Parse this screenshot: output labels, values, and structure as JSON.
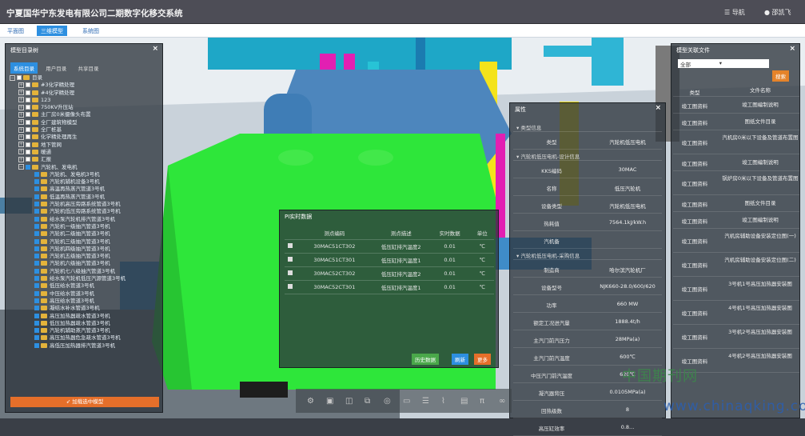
{
  "app": {
    "title": "宁夏国华宁东发电有限公司二期数字化移交系统",
    "nav_label": "导航",
    "user": "邵凯飞",
    "nav_icon": "menu-icon",
    "user_icon": "user-icon"
  },
  "view_tabs": [
    {
      "label": "平面图",
      "active": false
    },
    {
      "label": "三维模型",
      "active": true
    },
    {
      "label": "系统图",
      "active": false
    }
  ],
  "tree": {
    "title": "模型目录树",
    "tabs": [
      {
        "label": "系统目录",
        "active": true
      },
      {
        "label": "用户目录",
        "active": false
      },
      {
        "label": "共享目录",
        "active": false
      }
    ],
    "items": [
      {
        "label": "目录",
        "level": 0,
        "folder": true,
        "checked": false,
        "exp": "−"
      },
      {
        "label": "#3化学精处理",
        "level": 1,
        "folder": true,
        "checked": false,
        "exp": "+"
      },
      {
        "label": "#4化学精处理",
        "level": 1,
        "folder": true,
        "checked": false,
        "exp": "+"
      },
      {
        "label": "123",
        "level": 1,
        "folder": true,
        "checked": false,
        "exp": "+"
      },
      {
        "label": "750KV升压站",
        "level": 1,
        "folder": true,
        "checked": false,
        "exp": "+"
      },
      {
        "label": "主厂房0米摄像头布置",
        "level": 1,
        "folder": true,
        "checked": false,
        "exp": "+"
      },
      {
        "label": "全厂建筑物模型",
        "level": 1,
        "folder": true,
        "checked": false,
        "exp": "+"
      },
      {
        "label": "全厂桩基",
        "level": 1,
        "folder": true,
        "checked": false,
        "exp": "+"
      },
      {
        "label": "化学精处理再生",
        "level": 1,
        "folder": true,
        "checked": false,
        "exp": "+"
      },
      {
        "label": "地下管网",
        "level": 1,
        "folder": true,
        "checked": false,
        "exp": "+"
      },
      {
        "label": "暖通",
        "level": 1,
        "folder": true,
        "checked": false,
        "exp": "+"
      },
      {
        "label": "汇报",
        "level": 1,
        "folder": true,
        "checked": false,
        "exp": "+"
      },
      {
        "label": "汽轮机、发电机",
        "level": 1,
        "folder": true,
        "checked": true,
        "exp": "−"
      },
      {
        "label": "汽轮机、发电机3号机",
        "level": 2,
        "folder": true,
        "checked": true,
        "exp": ""
      },
      {
        "label": "汽轮机辅机设备3号机",
        "level": 2,
        "folder": true,
        "checked": true,
        "exp": ""
      },
      {
        "label": "高温再热蒸汽管道3号机",
        "level": 2,
        "folder": true,
        "checked": true,
        "exp": ""
      },
      {
        "label": "低温再热蒸汽管道3号机",
        "level": 2,
        "folder": true,
        "checked": true,
        "exp": ""
      },
      {
        "label": "汽轮机高压旁路系统管道3号机",
        "level": 2,
        "folder": true,
        "checked": true,
        "exp": ""
      },
      {
        "label": "汽轮机低压旁路系统管道3号机",
        "level": 2,
        "folder": true,
        "checked": true,
        "exp": ""
      },
      {
        "label": "给水泵汽轮机排汽管道3号机",
        "level": 2,
        "folder": true,
        "checked": true,
        "exp": ""
      },
      {
        "label": "汽轮机一级抽汽管道3号机",
        "level": 2,
        "folder": true,
        "checked": true,
        "exp": ""
      },
      {
        "label": "汽轮机二级抽汽管道3号机",
        "level": 2,
        "folder": true,
        "checked": true,
        "exp": ""
      },
      {
        "label": "汽轮机三级抽汽管道3号机",
        "level": 2,
        "folder": true,
        "checked": true,
        "exp": ""
      },
      {
        "label": "汽轮机四级抽汽管道3号机",
        "level": 2,
        "folder": true,
        "checked": true,
        "exp": ""
      },
      {
        "label": "汽轮机五级抽汽管道3号机",
        "level": 2,
        "folder": true,
        "checked": true,
        "exp": ""
      },
      {
        "label": "汽轮机六级抽汽管道3号机",
        "level": 2,
        "folder": true,
        "checked": true,
        "exp": ""
      },
      {
        "label": "汽轮机七八级抽汽管道3号机",
        "level": 2,
        "folder": true,
        "checked": true,
        "exp": ""
      },
      {
        "label": "给水泵汽轮机低压汽源管道3号机",
        "level": 2,
        "folder": true,
        "checked": true,
        "exp": ""
      },
      {
        "label": "低压给水管道3号机",
        "level": 2,
        "folder": true,
        "checked": true,
        "exp": ""
      },
      {
        "label": "中压给水管道3号机",
        "level": 2,
        "folder": true,
        "checked": true,
        "exp": ""
      },
      {
        "label": "高压给水管道3号机",
        "level": 2,
        "folder": true,
        "checked": true,
        "exp": ""
      },
      {
        "label": "凝结水补水管道3号机",
        "level": 2,
        "folder": true,
        "checked": true,
        "exp": ""
      },
      {
        "label": "高压加热器疏水管道3号机",
        "level": 2,
        "folder": true,
        "checked": true,
        "exp": ""
      },
      {
        "label": "低压加热器疏水管道3号机",
        "level": 2,
        "folder": true,
        "checked": true,
        "exp": ""
      },
      {
        "label": "汽轮机辅助蒸汽管道3号机",
        "level": 2,
        "folder": true,
        "checked": true,
        "exp": ""
      },
      {
        "label": "高压加热器危急疏水管道3号机",
        "level": 2,
        "folder": true,
        "checked": true,
        "exp": ""
      },
      {
        "label": "高低压加热器排汽管道3号机",
        "level": 2,
        "folder": true,
        "checked": true,
        "exp": ""
      }
    ],
    "load_button": "加载选中模型"
  },
  "pi": {
    "title": "PI实时数据",
    "headers": [
      "测点编码",
      "测点描述",
      "实时数据",
      "单位"
    ],
    "rows": [
      {
        "code": "30MAC51CT302",
        "desc": "低压缸排汽温度2",
        "value": "0.01",
        "unit": "℃"
      },
      {
        "code": "30MAC51CT301",
        "desc": "低压缸排汽温度1",
        "value": "0.01",
        "unit": "℃"
      },
      {
        "code": "30MAC52CT302",
        "desc": "低压缸排汽温度2",
        "value": "0.01",
        "unit": "℃"
      },
      {
        "code": "30MAC52CT301",
        "desc": "低压缸排汽温度1",
        "value": "0.01",
        "unit": "℃"
      }
    ],
    "buttons": {
      "history": "历史数据",
      "refresh": "刷新",
      "more": "更多"
    }
  },
  "props": {
    "title": "属性",
    "sections": [
      {
        "name": "类型信息",
        "rows": [
          {
            "k": "类型",
            "v": "汽轮机低压电机"
          }
        ]
      },
      {
        "name": "汽轮机低压电机-设计信息",
        "rows": [
          {
            "k": "KKS编码",
            "v": "30MAC"
          },
          {
            "k": "名称",
            "v": "低压汽轮机"
          },
          {
            "k": "设备类型",
            "v": "汽轮机低压电机"
          },
          {
            "k": "热耗值",
            "v": "7564.1kJ/kW.h"
          },
          {
            "k": "汽机备",
            "v": ""
          }
        ]
      },
      {
        "name": "汽轮机低压电机-采购信息",
        "rows": [
          {
            "k": "制造商",
            "v": "哈尔滨汽轮机厂"
          },
          {
            "k": "设备型号",
            "v": "NJK660-28.0/600/620"
          },
          {
            "k": "功率",
            "v": "660 MW"
          },
          {
            "k": "额定工况进汽量",
            "v": "1888.4t/h"
          },
          {
            "k": "主汽门前汽压力",
            "v": "28MPa(a)"
          },
          {
            "k": "主汽门前汽温度",
            "v": "600℃"
          },
          {
            "k": "中压汽门前汽温度",
            "v": "620℃"
          },
          {
            "k": "凝汽器背压",
            "v": "0.0105MPa(a)"
          },
          {
            "k": "回热级数",
            "v": "8"
          },
          {
            "k": "高压缸效率",
            "v": "0.8..."
          }
        ]
      }
    ]
  },
  "docs": {
    "title": "模型关联文件",
    "filter": "全部",
    "search_button": "搜索",
    "headers": [
      "类型",
      "文件名称"
    ],
    "rows": [
      {
        "type": "竣工图资料",
        "name": "竣工图编制说明"
      },
      {
        "type": "竣工图资料",
        "name": "图纸文件目录"
      },
      {
        "type": "竣工图资料",
        "name": "汽机房0米以下设备及管道布置图"
      },
      {
        "type": "竣工图资料",
        "name": "竣工图编制说明"
      },
      {
        "type": "竣工图资料",
        "name": "锅炉房0米以下设备及管道布置图"
      },
      {
        "type": "竣工图资料",
        "name": "图纸文件目录"
      },
      {
        "type": "竣工图资料",
        "name": "竣工图编制说明"
      },
      {
        "type": "竣工图资料",
        "name": "汽机房辅助设备安装定位图(一)"
      },
      {
        "type": "竣工图资料",
        "name": "汽机房辅助设备安装定位图(二)"
      },
      {
        "type": "竣工图资料",
        "name": "3号机1号高压加热器安装图"
      },
      {
        "type": "竣工图资料",
        "name": "4号机1号高压加热器安装图"
      },
      {
        "type": "竣工图资料",
        "name": "3号机2号高压加热器安装图"
      },
      {
        "type": "竣工图资料",
        "name": "4号机2号高压加热器安装图"
      }
    ]
  },
  "toolbar": {
    "icons": [
      "settings-icon",
      "cube-icon",
      "box-icon",
      "layers-icon",
      "target-icon",
      "folder-icon",
      "list-icon",
      "clip-icon",
      "document-icon",
      "pi-icon",
      "link-icon"
    ]
  },
  "watermark": {
    "cn": "中国期刊网",
    "en": "www.chinaqking.com"
  }
}
